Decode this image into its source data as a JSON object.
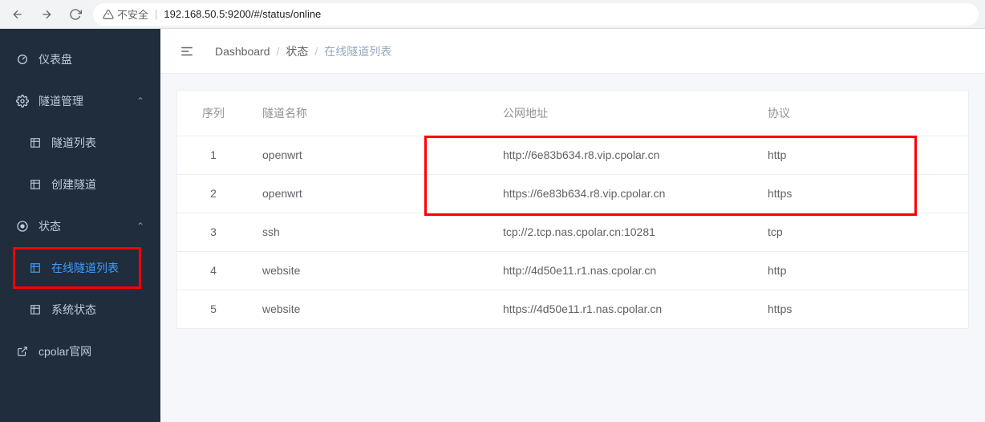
{
  "browser": {
    "url": "192.168.50.5:9200/#/status/online",
    "insecure_label": "不安全"
  },
  "sidebar": {
    "dashboard": "仪表盘",
    "tunnel_mgmt": "隧道管理",
    "tunnel_list": "隧道列表",
    "create_tunnel": "创建隧道",
    "status": "状态",
    "online_list": "在线隧道列表",
    "system_status": "系统状态",
    "official_site": "cpolar官网"
  },
  "breadcrumb": {
    "b0": "Dashboard",
    "b1": "状态",
    "b2": "在线隧道列表"
  },
  "table": {
    "headers": {
      "seq": "序列",
      "name": "隧道名称",
      "addr": "公网地址",
      "proto": "协议"
    },
    "rows": [
      {
        "seq": "1",
        "name": "openwrt",
        "addr": "http://6e83b634.r8.vip.cpolar.cn",
        "proto": "http"
      },
      {
        "seq": "2",
        "name": "openwrt",
        "addr": "https://6e83b634.r8.vip.cpolar.cn",
        "proto": "https"
      },
      {
        "seq": "3",
        "name": "ssh",
        "addr": "tcp://2.tcp.nas.cpolar.cn:10281",
        "proto": "tcp"
      },
      {
        "seq": "4",
        "name": "website",
        "addr": "http://4d50e11.r1.nas.cpolar.cn",
        "proto": "http"
      },
      {
        "seq": "5",
        "name": "website",
        "addr": "https://4d50e11.r1.nas.cpolar.cn",
        "proto": "https"
      }
    ]
  }
}
